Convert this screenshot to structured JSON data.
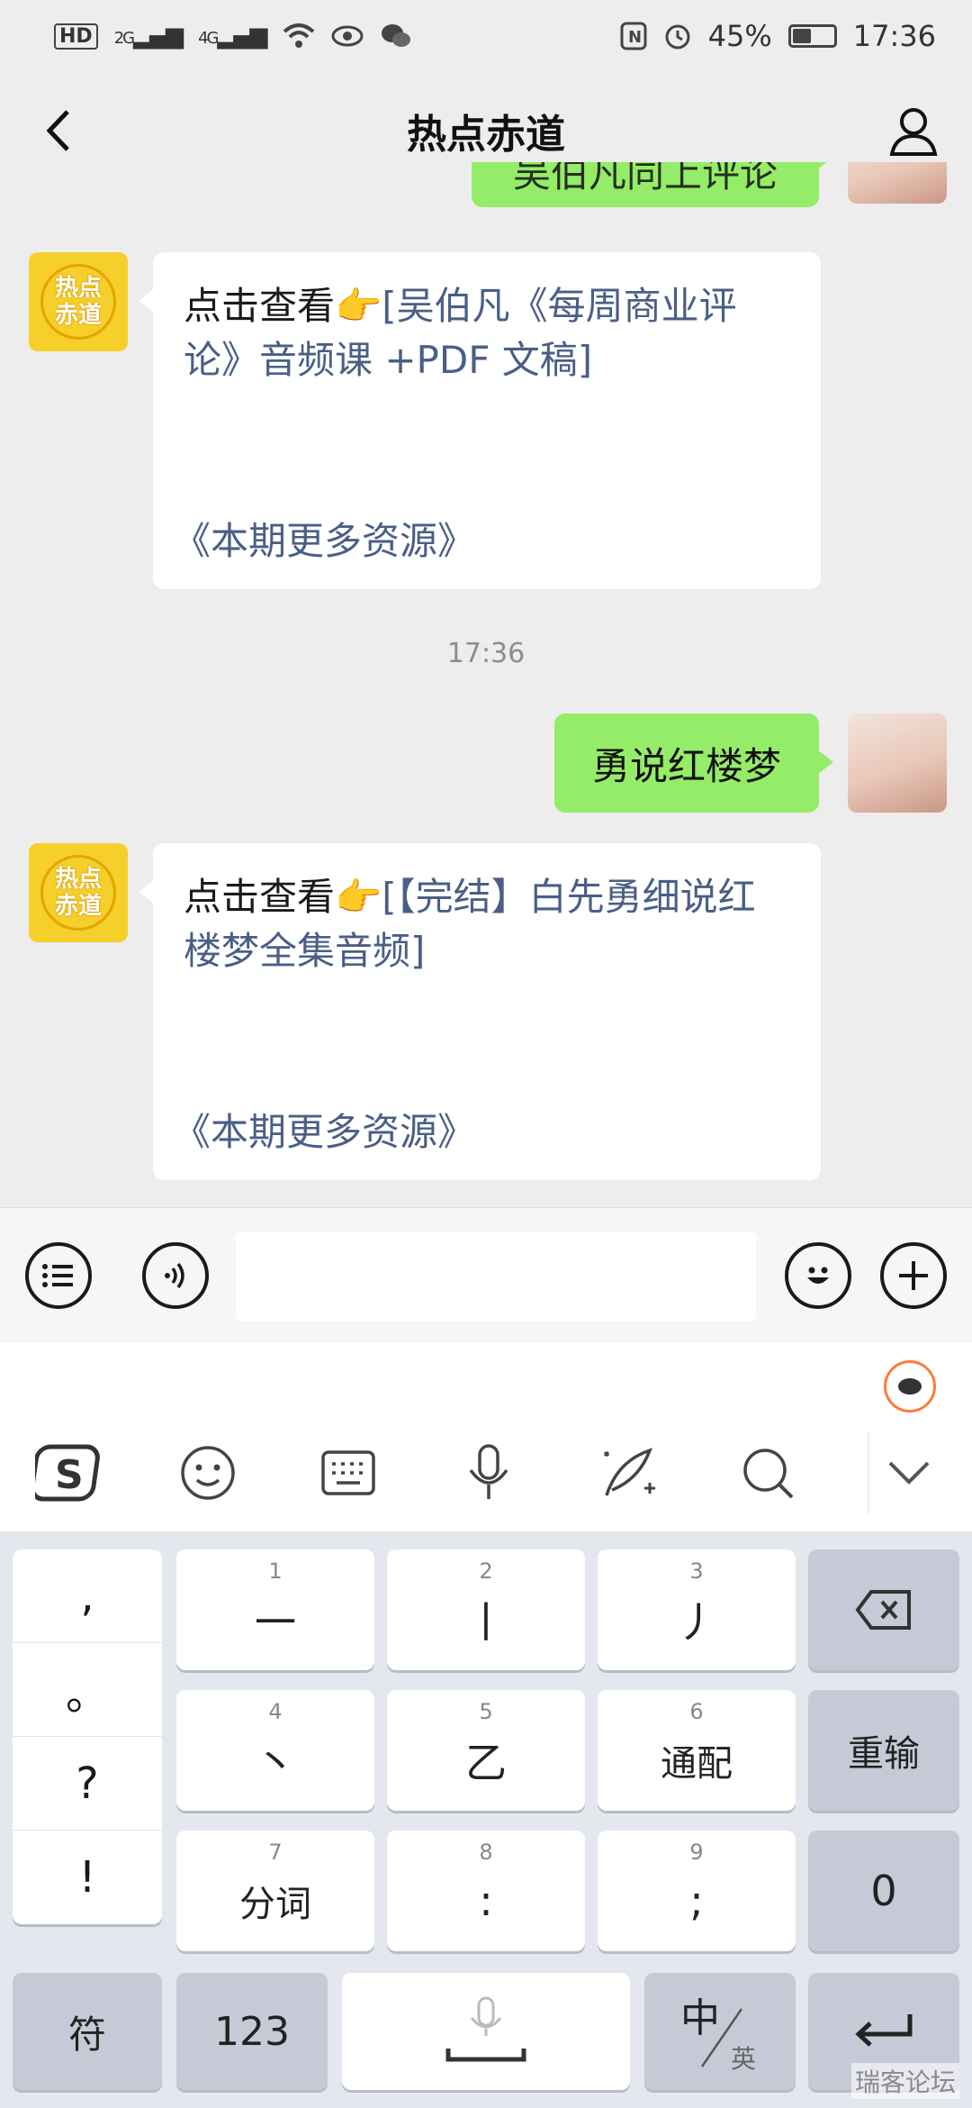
{
  "status_bar": {
    "hd": "HD",
    "sig1": "2G",
    "sig2": "4G",
    "battery": "45%",
    "battery_level": 0.45,
    "time": "17:36"
  },
  "header": {
    "title": "热点赤道"
  },
  "messages": {
    "top_partial": "吴伯凡同上评论",
    "card1": {
      "prefix": "点击查看👉",
      "link": "[吴伯凡《每周商业评论》音频课 +PDF 文稿]",
      "more": "《本期更多资源》"
    },
    "timestamp": "17:36",
    "user_msg": "勇说红楼梦",
    "card2": {
      "prefix": "点击查看👉",
      "link": "[【完结】白先勇细说红楼梦全集音频]",
      "more": "《本期更多资源》"
    },
    "bot_avatar_text_1": "热点",
    "bot_avatar_text_2": "赤道"
  },
  "input": {
    "placeholder": ""
  },
  "keyboard": {
    "punct": [
      ",",
      "。",
      "?",
      "!"
    ],
    "keys": [
      {
        "num": "1",
        "label": "一"
      },
      {
        "num": "2",
        "label": "丨"
      },
      {
        "num": "3",
        "label": "丿"
      },
      {
        "num": "4",
        "label": "丶"
      },
      {
        "num": "5",
        "label": "乙"
      },
      {
        "num": "6",
        "label": "通配"
      },
      {
        "num": "7",
        "label": "分词"
      },
      {
        "num": "8",
        "label": ":"
      },
      {
        "num": "9",
        "label": ";"
      }
    ],
    "reenter": "重输",
    "zero": "0",
    "symbol": "符",
    "numbers": "123",
    "lang_main": "中",
    "lang_sub": "英"
  },
  "watermark": "瑞客论坛"
}
